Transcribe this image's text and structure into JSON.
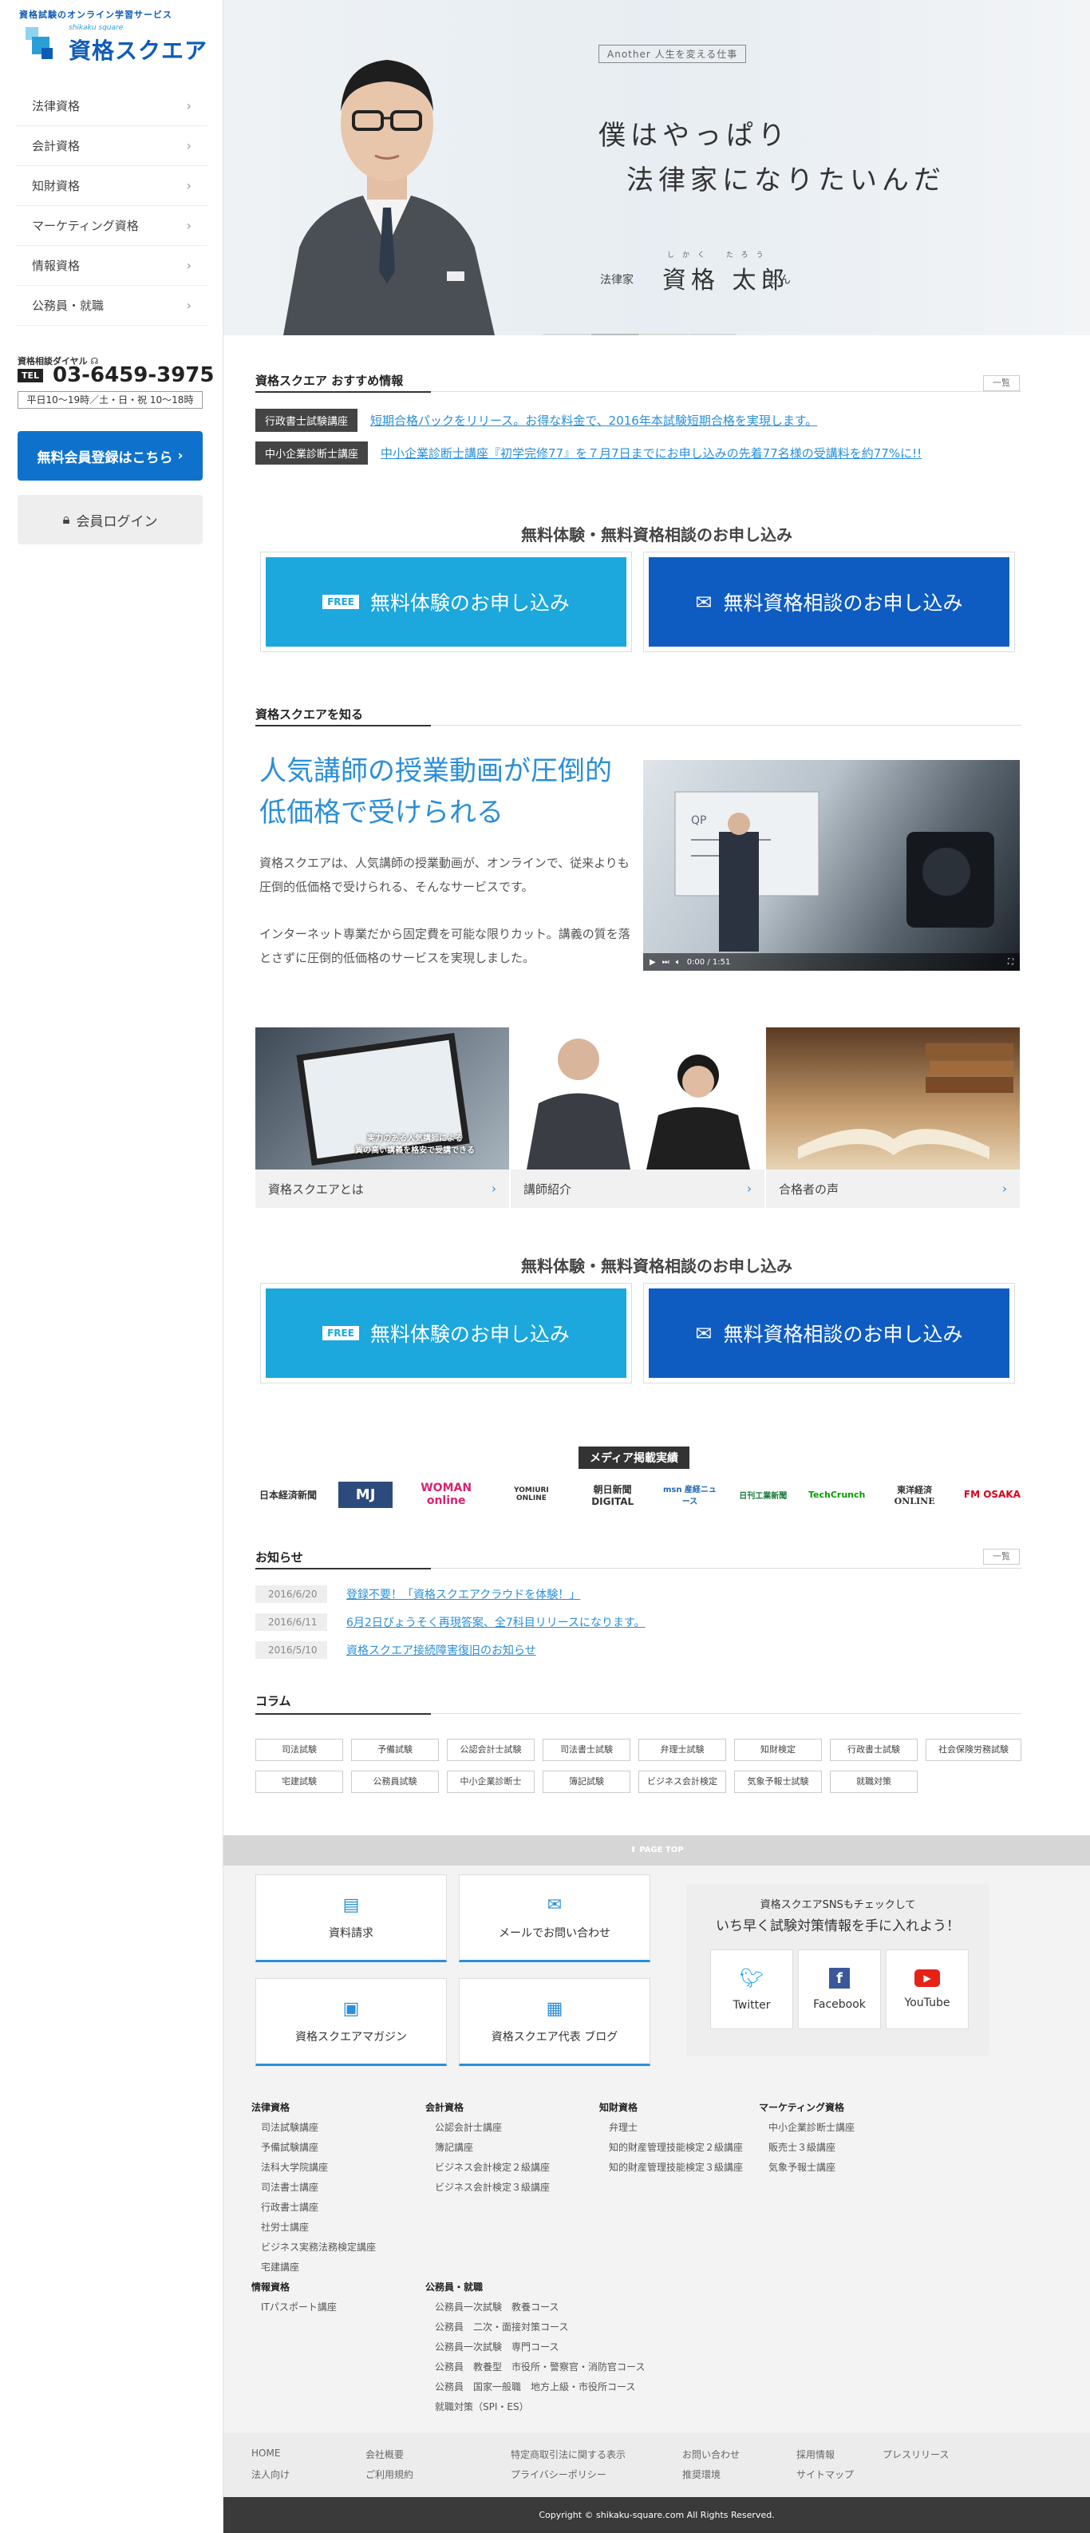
{
  "sidebar": {
    "tagline": "資格試験のオンライン学習サービス",
    "logo_sub": "shikaku square",
    "logo_name": "資格スクエア",
    "nav": [
      "法律資格",
      "会計資格",
      "知財資格",
      "マーケティング資格",
      "情報資格",
      "公務員・就職"
    ],
    "dial_label": "資格相談ダイヤル",
    "tel_badge": "TEL",
    "tel_number": "03-6459-3975",
    "tel_hours": "平日10〜19時／土・日・祝 10〜18時",
    "register_label": "無料会員登録はこちら",
    "login_label": "会員ログイン"
  },
  "hero": {
    "another": "Another  人生を変える仕事",
    "line1": "僕はやっぱり",
    "line2": "法律家になりたいんだ",
    "role": "法律家",
    "name": "資格 太郎",
    "ruby_surname": "しかく",
    "ruby_given": "たろう",
    "honorific": "さん"
  },
  "recommend": {
    "title": "資格スクエア おすすめ情報",
    "more": "一覧",
    "items": [
      {
        "tag": "行政書士試験講座",
        "text": "短期合格パックをリリース。お得な料金で、2016年本試験短期合格を実現します。"
      },
      {
        "tag": "中小企業診断士講座",
        "text": "中小企業診断士講座『初学完修77』を７月7日までにお申し込みの先着77名様の受講料を約77%に!!"
      }
    ]
  },
  "cta": {
    "title": "無料体験・無料資格相談のお申し込み",
    "free_badge": "FREE",
    "free_label": "無料体験のお申し込み",
    "consult_label": "無料資格相談のお申し込み"
  },
  "about": {
    "section_title": "資格スクエアを知る",
    "headline1": "人気講師の授業動画が圧倒的",
    "headline2": "低価格で受けられる",
    "p1": "資格スクエアは、人気講師の授業動画が、オンラインで、従来よりも圧倒的低価格で受けられる、そんなサービスです。",
    "p2": "インターネット専業だから固定費を可能な限りカット。講義の質を落とさずに圧倒的低価格のサービスを実現しました。",
    "video_time": "0:00 / 1:51",
    "cards": [
      "資格スクエアとは",
      "講師紹介",
      "合格者の声"
    ],
    "card1_caption": "実力のある人気講師による\n質の高い講義を格安で受講できる"
  },
  "media": {
    "title": "メディア掲載実績",
    "logos": [
      "日本経済新聞",
      "MJ",
      "WOMAN online",
      "YOMIURI ONLINE",
      "朝日新聞 DIGITAL",
      "msn 産経ニュース",
      "日刊工業新聞",
      "TechCrunch",
      "東洋経済 ONLINE",
      "FM OSAKA"
    ],
    "colors": {
      "mj": "#2d4a7c",
      "woman": "#d6246f",
      "techcrunch": "#0a9e01",
      "fm": "#d8001c"
    }
  },
  "notices": {
    "title": "お知らせ",
    "more": "一覧",
    "items": [
      {
        "date": "2016/6/20",
        "text": "登録不要！「資格スクエアクラウドを体験！」"
      },
      {
        "date": "2016/6/11",
        "text": "6月2日びょうそく再現答案、全7科目リリースになります。"
      },
      {
        "date": "2016/5/10",
        "text": "資格スクエア接続障害復旧のお知らせ"
      }
    ]
  },
  "column": {
    "title": "コラム",
    "tags_row1": [
      "司法試験",
      "予備試験",
      "公認会計士試験",
      "司法書士試験",
      "弁理士試験",
      "知財検定",
      "行政書士試験",
      "社会保険労務試験"
    ],
    "tags_row2": [
      "宅建試験",
      "公務員試験",
      "中小企業診断士",
      "簿記試験",
      "ビジネス会計検定",
      "気象予報士試験",
      "就職対策"
    ]
  },
  "footer": {
    "pagetop": "PAGE TOP",
    "links": [
      "資料請求",
      "メールでお問い合わせ",
      "資格スクエアマガジン",
      "資格スクエア代表 ブログ"
    ],
    "sns_line1": "資格スクエアSNSもチェックして",
    "sns_line2": "いち早く試験対策情報を手に入れよう！",
    "sns": [
      "Twitter",
      "Facebook",
      "YouTube"
    ],
    "sns_colors": {
      "twitter": "#1da1f2",
      "facebook": "#3b5998",
      "youtube": "#e62117"
    },
    "cols": [
      {
        "head": "法律資格",
        "items": [
          "司法試験講座",
          "予備試験講座",
          "法科大学院講座",
          "司法書士講座",
          "行政書士講座",
          "社労士講座",
          "ビジネス実務法務検定講座",
          "宅建講座"
        ]
      },
      {
        "head": "会計資格",
        "items": [
          "公認会計士講座",
          "簿記講座",
          "ビジネス会計検定２級講座",
          "ビジネス会計検定３級講座"
        ]
      },
      {
        "head": "知財資格",
        "items": [
          "弁理士",
          "知的財産管理技能検定２級講座",
          "知的財産管理技能検定３級講座"
        ]
      },
      {
        "head": "マーケティング資格",
        "items": [
          "中小企業診断士講座",
          "販売士３級講座",
          "気象予報士講座"
        ]
      },
      {
        "head": "情報資格",
        "items": [
          "ITパスポート講座"
        ]
      },
      {
        "head": "公務員・就職",
        "items": [
          "公務員一次試験　教養コース",
          "公務員　二次・面接対策コース",
          "公務員一次試験　専門コース",
          "公務員　教養型　市役所・警察官・消防官コース",
          "公務員　国家一般職　地方上級・市役所コース",
          "就職対策（SPI・ES）"
        ]
      }
    ],
    "bottom": [
      "HOME",
      "会社概要",
      "特定商取引法に関する表示",
      "お問い合わせ",
      "採用情報",
      "プレスリリース",
      "法人向け",
      "ご利用規約",
      "プライバシーポリシー",
      "推奨環境",
      "サイトマップ"
    ],
    "copyright": "Copyright © shikaku-square.com All Rights Reserved."
  }
}
